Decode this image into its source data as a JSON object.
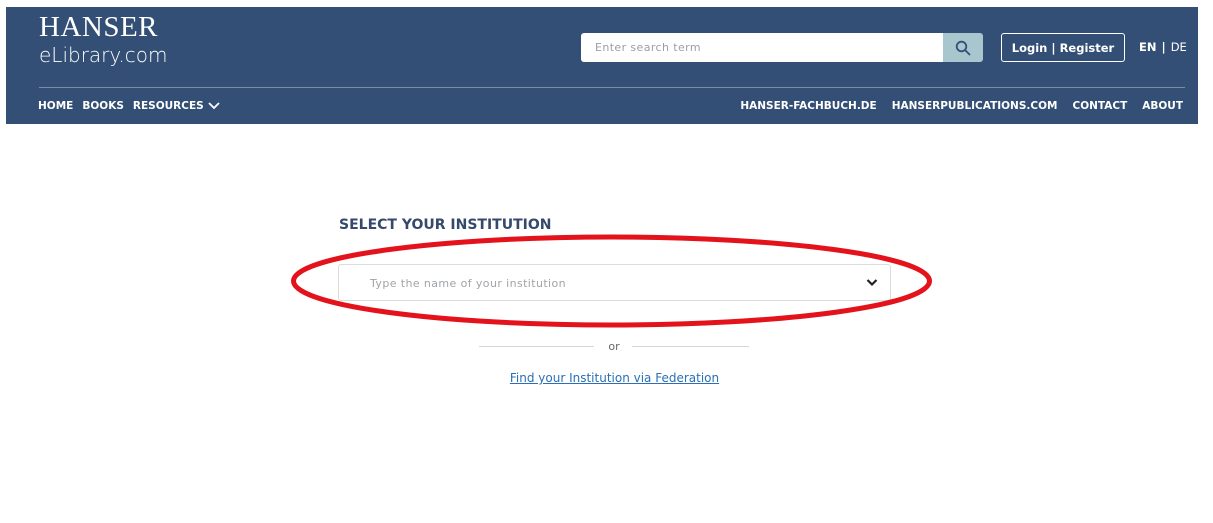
{
  "header": {
    "logo_title": "HANSER",
    "logo_subtitle": "eLibrary.com",
    "search_placeholder": "Enter search term",
    "login_label": "Login | Register",
    "lang_en": "EN",
    "lang_sep": "|",
    "lang_de": "DE"
  },
  "nav": {
    "left": [
      "HOME",
      "BOOKS",
      "RESOURCES"
    ],
    "right": [
      "HANSER-FACHBUCH.DE",
      "HANSERPUBLICATIONS.COM",
      "CONTACT",
      "ABOUT"
    ]
  },
  "main": {
    "title": "SELECT YOUR INSTITUTION",
    "select_placeholder": "Type the name of your institution",
    "or_text": "or",
    "federation_link": "Find your Institution via Federation"
  },
  "colors": {
    "header_bg": "#344f75",
    "search_button": "#a7c6ce",
    "title_text": "#34496b",
    "link": "#2a6fb8",
    "highlight_ellipse": "#e3121b"
  }
}
